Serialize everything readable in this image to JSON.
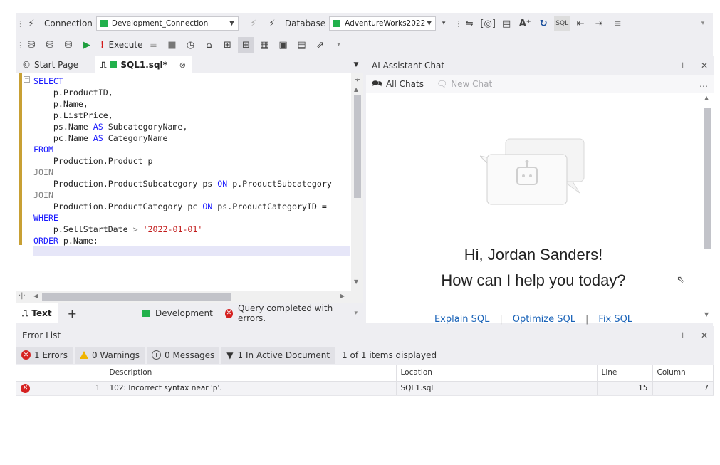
{
  "toolbar1": {
    "connection_label": "Connection",
    "connection_value": "Development_Connection",
    "database_label": "Database",
    "database_value": "AdventureWorks2022"
  },
  "toolbar2": {
    "execute_label": "Execute"
  },
  "doc_tabs": [
    {
      "label": "Start Page"
    },
    {
      "label": "SQL1.sql*"
    }
  ],
  "editor": {
    "lines": [
      [
        {
          "t": "SELECT",
          "c": "kw"
        }
      ],
      [
        {
          "t": "    p.ProductID,",
          "c": ""
        }
      ],
      [
        {
          "t": "    p.Name,",
          "c": ""
        }
      ],
      [
        {
          "t": "    p.ListPrice,",
          "c": ""
        }
      ],
      [
        {
          "t": "    ps.Name ",
          "c": ""
        },
        {
          "t": "AS",
          "c": "kw"
        },
        {
          "t": " SubcategoryName,",
          "c": ""
        }
      ],
      [
        {
          "t": "    pc.Name ",
          "c": ""
        },
        {
          "t": "AS",
          "c": "kw"
        },
        {
          "t": " CategoryName",
          "c": ""
        }
      ],
      [
        {
          "t": "FROM",
          "c": "kw"
        }
      ],
      [
        {
          "t": "    Production.Product p",
          "c": ""
        }
      ],
      [
        {
          "t": "JOIN",
          "c": "kwg"
        }
      ],
      [
        {
          "t": "    Production.ProductSubcategory ps ",
          "c": ""
        },
        {
          "t": "ON",
          "c": "kw"
        },
        {
          "t": " p.ProductSubcategory",
          "c": ""
        }
      ],
      [
        {
          "t": "JOIN",
          "c": "kwg"
        }
      ],
      [
        {
          "t": "    Production.ProductCategory pc ",
          "c": ""
        },
        {
          "t": "ON",
          "c": "kw"
        },
        {
          "t": " ps.ProductCategoryID =",
          "c": ""
        }
      ],
      [
        {
          "t": "WHERE",
          "c": "kw"
        }
      ],
      [
        {
          "t": "    p.SellStartDate ",
          "c": ""
        },
        {
          "t": ">",
          "c": "kwg"
        },
        {
          "t": " ",
          "c": ""
        },
        {
          "t": "'2022-01-01'",
          "c": "str"
        }
      ],
      [
        {
          "t": "ORDER",
          "c": "kw"
        },
        {
          "t": " p.Name;",
          "c": ""
        }
      ]
    ]
  },
  "editor_status": {
    "tab_text": "Text",
    "connection": "Development",
    "message": "Query completed with errors."
  },
  "ai_panel": {
    "title": "AI Assistant Chat",
    "all_chats": "All Chats",
    "new_chat": "New Chat",
    "greeting": "Hi, Jordan Sanders!",
    "prompt": "How can I help you today?",
    "suggestions": [
      "Explain SQL",
      "Optimize SQL",
      "Fix SQL"
    ]
  },
  "error_list": {
    "title": "Error List",
    "filters": {
      "errors": "1 Errors",
      "warnings": "0 Warnings",
      "messages": "0 Messages",
      "active_doc": "1 In Active Document",
      "displayed": "1 of 1 items displayed"
    },
    "columns": [
      "",
      "",
      "Description",
      "Location",
      "Line",
      "Column"
    ],
    "rows": [
      {
        "index": "1",
        "description": "102: Incorrect syntax near 'p'.",
        "location": "SQL1.sql",
        "line": "15",
        "column": "7"
      }
    ]
  },
  "colors": {
    "accent_green": "#22b14c",
    "error_red": "#d52121",
    "keyword_blue": "#1a1aff",
    "string_red": "#c21b1b",
    "link_blue": "#1a63b8"
  }
}
